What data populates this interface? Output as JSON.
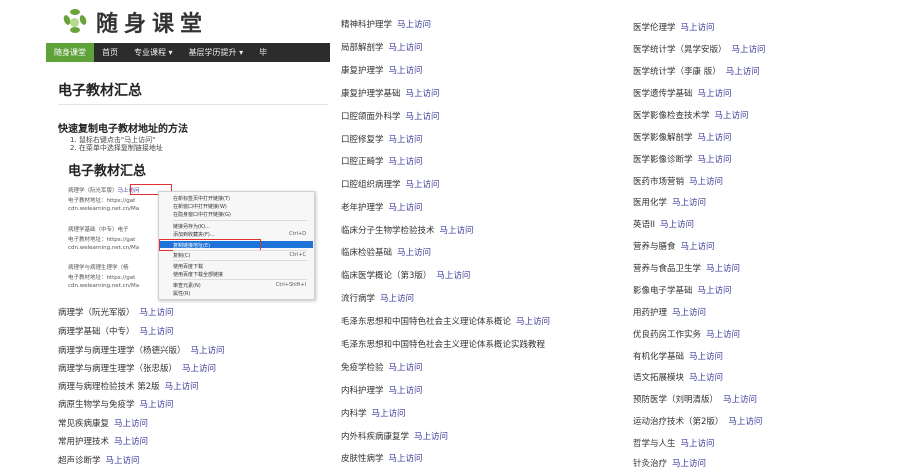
{
  "site": {
    "logo_text": "随身课堂",
    "logo_icon": "leaf-flower-icon",
    "accent_color": "#5fa239"
  },
  "nav": {
    "items": [
      "随身课堂",
      "首页",
      "专业课程 ▾",
      "基层学历提升 ▾",
      "毕"
    ]
  },
  "page": {
    "title": "电子教材汇总",
    "subtitle": "快速复制电子教材地址的方法",
    "steps": [
      "1. 鼠标右键点击\"马上访问\"",
      "2. 在菜单中选择复制链接地址"
    ],
    "inner_title": "电子教材汇总"
  },
  "screenshot": {
    "lines": [
      {
        "text": "病理学（阮光军版）",
        "link": "马上访问"
      },
      {
        "text": "电子教材地址：https://gat",
        "link": ""
      },
      {
        "text": "cdn.welearning.net.cn/Ma",
        "link": ""
      },
      {
        "text": "病理学基础（中专）电子",
        "link": ""
      },
      {
        "text": "电子教材地址：https://gat",
        "link": ""
      },
      {
        "text": "cdn.welearning.net.cn/Ma",
        "link": ""
      },
      {
        "text": "病理学与病理生理学（杨",
        "link": ""
      },
      {
        "text": "电子教材地址：https://gat",
        "link": ""
      },
      {
        "text": "cdn.welearning.net.cn/Ma",
        "link": ""
      }
    ]
  },
  "context_menu": {
    "items": [
      {
        "label": "在新标签页中打开链接(T)",
        "key": ""
      },
      {
        "label": "在新窗口中打开链接(W)",
        "key": ""
      },
      {
        "label": "在隐身窗口中打开链接(G)",
        "key": ""
      },
      {
        "label": "链接另存为(K)...",
        "key": ""
      },
      {
        "label": "添加到收藏夹(F)...",
        "key": "Ctrl+D"
      },
      {
        "label": "复制链接地址(E)",
        "key": ""
      },
      {
        "label": "复制(C)",
        "key": "Ctrl+C"
      },
      {
        "label": "使用百度下载",
        "key": ""
      },
      {
        "label": "使用百度下载全部链接",
        "key": ""
      },
      {
        "label": "审查元素(N)",
        "key": "Ctrl+Shift+I"
      },
      {
        "label": "属性(R)",
        "key": ""
      }
    ],
    "highlight_color": "#1e73d9"
  },
  "lists": {
    "link_label": "马上访问",
    "col1": [
      "病理学（阮光军版）",
      "病理学基础（中专）",
      "病理学与病理生理学（杨德兴版）",
      "病理学与病理生理学（张忠版）",
      "病理与病理检验技术 第2版",
      "病原生物学与免疫学",
      "常见疾病康复",
      "常用护理技术",
      "超声诊断学"
    ],
    "col2": [
      "精神科护理学",
      "局部解剖学",
      "康复护理学",
      "康复护理学基础",
      "口腔颌面外科学",
      "口腔修复学",
      "口腔正畸学",
      "口腔组织病理学",
      "老年护理学",
      "临床分子生物学检验技术",
      "临床检验基础",
      "临床医学概论（第3版）",
      "流行病学",
      "毛泽东思想和中国特色社会主义理论体系概论",
      "毛泽东思想和中国特色社会主义理论体系概论实践教程",
      "免疫学检验",
      "内科护理学",
      "内科学",
      "内外科疾病康复学",
      "皮肤性病学"
    ],
    "col3": [
      "医学伦理学",
      "医学统计学（晁学安版）",
      "医学统计学（李康 版）",
      "医学遗传学基础",
      "医学影像检查技术学",
      "医学影像解剖学",
      "医学影像诊断学",
      "医药市场营销",
      "医用化学",
      "英语II",
      "营养与膳食",
      "营养与食品卫生学",
      "影像电子学基础",
      "用药护理",
      "优良药房工作实务",
      "有机化学基础",
      "语文拓展模块",
      "预防医学（刘明清版）",
      "运动治疗技术（第2版）",
      "哲学与人生",
      "针灸治疗"
    ]
  }
}
